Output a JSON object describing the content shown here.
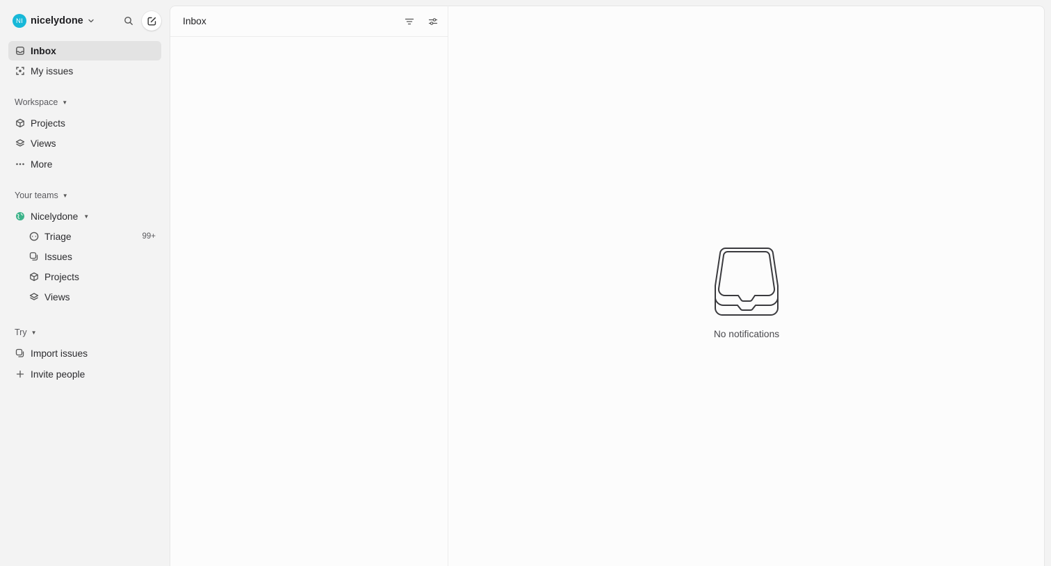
{
  "workspace": {
    "avatar_initials": "NI",
    "name": "nicelydone",
    "avatar_color": "#17b8d8"
  },
  "sidebar": {
    "primary": [
      {
        "label": "Inbox",
        "icon": "inbox-icon",
        "active": true
      },
      {
        "label": "My issues",
        "icon": "target-icon",
        "active": false
      }
    ],
    "workspace_section": {
      "label": "Workspace",
      "items": [
        {
          "label": "Projects",
          "icon": "cube-icon"
        },
        {
          "label": "Views",
          "icon": "layers-icon"
        },
        {
          "label": "More",
          "icon": "ellipsis-icon"
        }
      ]
    },
    "teams_section": {
      "label": "Your teams",
      "team": {
        "label": "Nicelydone",
        "icon": "team-globe-icon"
      },
      "items": [
        {
          "label": "Triage",
          "icon": "triage-icon",
          "badge": "99+"
        },
        {
          "label": "Issues",
          "icon": "issues-icon"
        },
        {
          "label": "Projects",
          "icon": "cube-icon"
        },
        {
          "label": "Views",
          "icon": "layers-icon"
        }
      ]
    },
    "try_section": {
      "label": "Try",
      "items": [
        {
          "label": "Import issues",
          "icon": "import-icon"
        },
        {
          "label": "Invite people",
          "icon": "plus-icon"
        }
      ]
    }
  },
  "list_panel": {
    "title": "Inbox"
  },
  "detail_panel": {
    "empty_message": "No notifications"
  }
}
